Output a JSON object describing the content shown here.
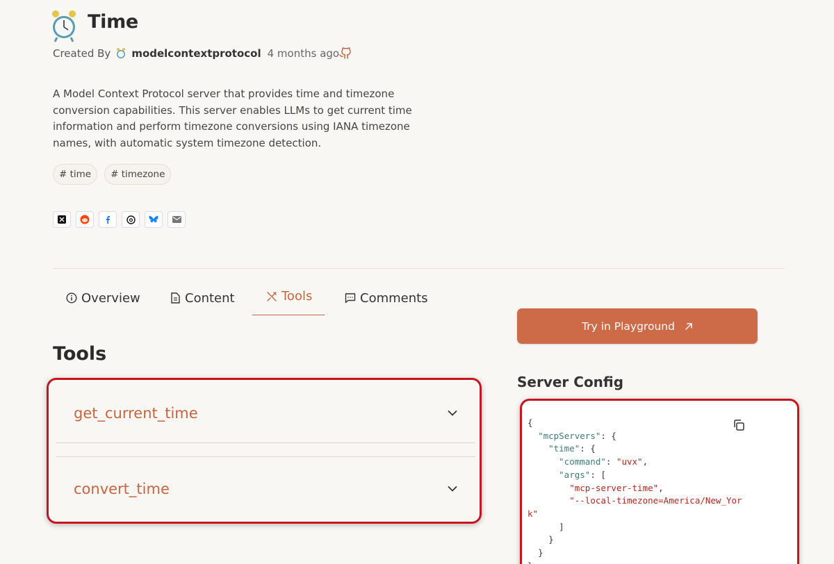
{
  "header": {
    "title": "Time",
    "created_by_label": "Created By",
    "author": "modelcontextprotocol",
    "time_ago": "4 months ago"
  },
  "description": "A Model Context Protocol server that provides time and timezone conversion capabilities. This server enables LLMs to get current time information and perform timezone conversions using IANA timezone names, with automatic system timezone detection.",
  "tags": [
    "# time",
    "# timezone"
  ],
  "share": [
    "x-icon",
    "reddit-icon",
    "facebook-icon",
    "threads-icon",
    "bluesky-icon",
    "email-icon"
  ],
  "tabs": [
    {
      "label": "Overview",
      "icon": "info-icon"
    },
    {
      "label": "Content",
      "icon": "document-icon"
    },
    {
      "label": "Tools",
      "icon": "tools-icon",
      "active": true
    },
    {
      "label": "Comments",
      "icon": "comment-icon"
    }
  ],
  "tools_section": {
    "title": "Tools",
    "items": [
      "get_current_time",
      "convert_time"
    ]
  },
  "sidebar": {
    "playground_label": "Try in Playground",
    "config_title": "Server Config",
    "config_code": {
      "l1": "{",
      "l2_key": "\"mcpServers\"",
      "l3_key": "\"time\"",
      "l4_key": "\"command\"",
      "l4_val": "\"uvx\"",
      "l5_key": "\"args\"",
      "l6_val": "\"mcp-server-time\"",
      "l7_val": "\"--local-timezone=America/New_Yor",
      "l8_val": "k\"",
      "l9": "]",
      "l10": "}",
      "l11": "}",
      "l12": "}"
    }
  },
  "colors": {
    "accent": "#c8643e",
    "button": "#cd6a47",
    "highlight_border": "#c8141e",
    "background": "#f9f7f3"
  }
}
